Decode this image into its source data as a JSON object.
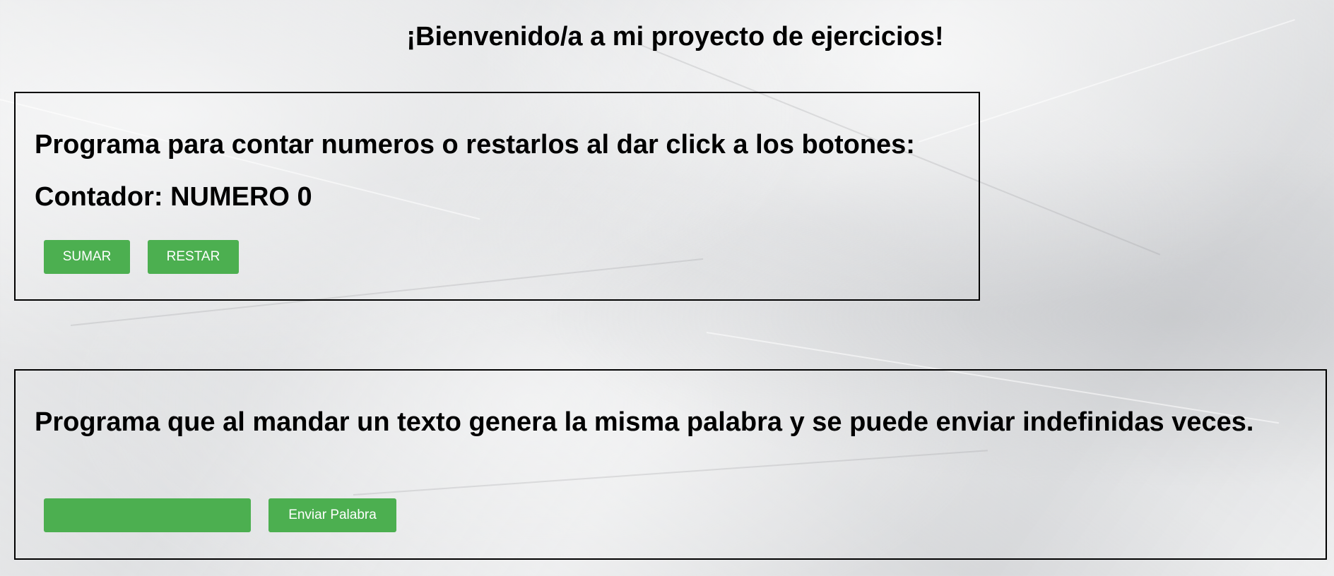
{
  "page": {
    "title": "¡Bienvenido/a a mi proyecto de ejercicios!"
  },
  "counter_section": {
    "heading": "Programa para contar numeros o restarlos al dar click a los botones:",
    "counter_label": "Contador:",
    "counter_value": "NUMERO 0",
    "add_label": "SUMAR",
    "subtract_label": "RESTAR"
  },
  "text_section": {
    "heading": "Programa que al mandar un texto genera la misma palabra y se puede enviar indefinidas veces.",
    "input_value": "",
    "send_label": "Enviar Palabra"
  },
  "colors": {
    "button_background": "#4caf50",
    "button_text": "#ffffff",
    "panel_border": "#000000"
  }
}
